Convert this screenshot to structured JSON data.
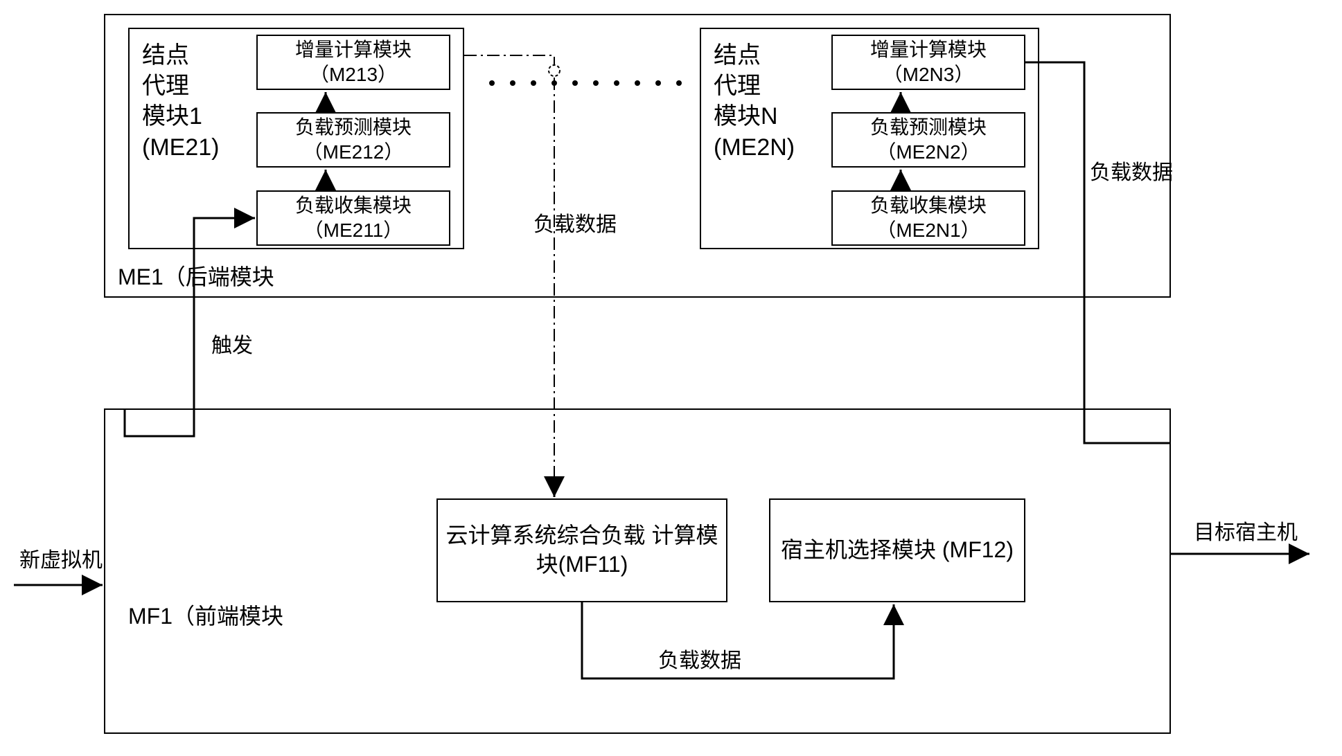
{
  "me1": {
    "caption": "ME1（后端模块",
    "node1": {
      "title": "结点\n代理\n模块1\n(ME21)",
      "incr": "增量计算模块\n（M213）",
      "pred": "负载预测模块\n（ME212）",
      "coll": "负载收集模块\n（ME211）"
    },
    "nodeN": {
      "title": "结点\n代理\n模块N\n(ME2N)",
      "incr": "增量计算模块\n（M2N3）",
      "pred": "负载预测模块\n（ME2N2）",
      "coll": "负载收集模块\n（ME2N1）"
    }
  },
  "mf1": {
    "caption": "MF1（前端模块",
    "calc": "云计算系统综合负载\n计算模块(MF11)",
    "select": "宿主机选择模块\n(MF12)"
  },
  "labels": {
    "trigger": "触发",
    "load_data_mid": "负载数据",
    "load_data_right": "负载数据",
    "load_data_bottom": "负载数据",
    "new_vm": "新虚拟机",
    "target_host": "目标宿主机"
  }
}
